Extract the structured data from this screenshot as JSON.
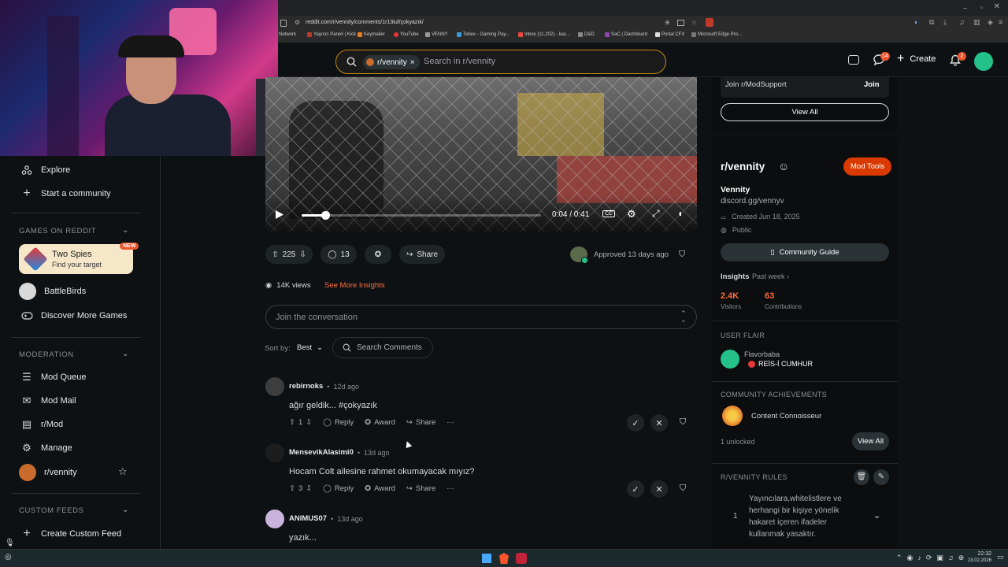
{
  "browser": {
    "url": "reddit.com/r/vennity/comments/1r13iuf/çokyazık/",
    "bookmarks": [
      "Network",
      "Yayıncı Paneli | Kick",
      "Keymailer",
      "YouTube",
      "VENNY",
      "Tebex - Gaming Pay...",
      "Inbox (11,202) - kas...",
      "D&D",
      "SaC | Dashboard",
      "Portal CFX",
      "Microsoft Edge Pro..."
    ]
  },
  "header": {
    "search_chip": "r/vennity",
    "search_placeholder": "Search in r/vennity",
    "chat_badge": "14",
    "create_label": "Create",
    "notif_badge": "2"
  },
  "sidebar": {
    "explore": "Explore",
    "start_community": "Start a community",
    "games_header": "GAMES ON REDDIT",
    "game_featured": {
      "title": "Two Spies",
      "subtitle": "Find your target",
      "badge": "NEW"
    },
    "game_2": "BattleBirds",
    "discover_games": "Discover More Games",
    "moderation_header": "MODERATION",
    "mod_queue": "Mod Queue",
    "mod_mail": "Mod Mail",
    "r_mod": "r/Mod",
    "manage": "Manage",
    "community": "r/vennity",
    "custom_feeds_header": "CUSTOM FEEDS",
    "create_feed": "Create Custom Feed"
  },
  "video": {
    "time": "0:04 / 0:41",
    "progress": 0.1
  },
  "post": {
    "votes": "225",
    "comments": "13",
    "share": "Share",
    "approved": "Approved 13 days ago",
    "views": "14K views",
    "insights": "See More Insights",
    "join_placeholder": "Join the conversation",
    "sort_label": "Sort by:",
    "sort_value": "Best",
    "search_comments": "Search Comments"
  },
  "comments": [
    {
      "author": "rebirnoks",
      "age": "12d ago",
      "text": "ağır geldik... #çokyazık",
      "votes": "1",
      "reply": "Reply",
      "award": "Award",
      "share": "Share"
    },
    {
      "author": "MensevikAlasimi0",
      "age": "13d ago",
      "text": "Hocam Colt ailesine rahmet okumayacak mıyız?",
      "votes": "3",
      "reply": "Reply",
      "award": "Award",
      "share": "Share"
    },
    {
      "author": "ANIMUS07",
      "age": "13d ago",
      "text": "yazık..."
    }
  ],
  "right": {
    "join_modsupport": "Join r/ModSupport",
    "join": "Join",
    "view_all": "View All",
    "community_name": "r/vennity",
    "mod_tools": "Mod Tools",
    "display_name": "Vennity",
    "desc": "discord.gg/vennyv",
    "created": "Created Jun 18, 2025",
    "visibility": "Public",
    "guide": "Community Guide",
    "insights": "Insights",
    "past_week": "Past week",
    "visitors_num": "2.4K",
    "visitors_label": "Visitors",
    "contrib_num": "63",
    "contrib_label": "Contributions",
    "user_flair_header": "USER FLAIR",
    "flair_user": "Flavorbaba",
    "flair_text": "REİS-İ CUMHUR",
    "achievements_header": "COMMUNITY ACHIEVEMENTS",
    "achievement": "Content Connoisseur",
    "unlocked": "1 unlocked",
    "rules_header": "R/VENNITY RULES",
    "rule_num": "1",
    "rule_text": "Yayıncılara,whitelistlere ve herhangi bir kişiye yönelik hakaret içeren ifadeler kullanmak yasaktır."
  },
  "taskbar": {
    "time": "22:32",
    "date": "23.02.2026"
  }
}
